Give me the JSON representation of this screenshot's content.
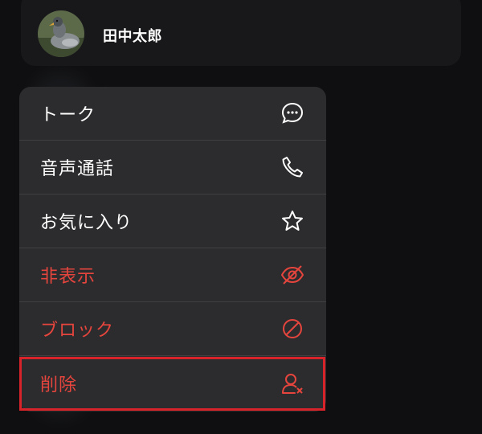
{
  "contact": {
    "name": "田中太郎",
    "avatar_icon": "duck-photo-avatar"
  },
  "menu": {
    "items": [
      {
        "label": "トーク",
        "icon": "chat-bubble-icon",
        "danger": false
      },
      {
        "label": "音声通話",
        "icon": "phone-icon",
        "danger": false
      },
      {
        "label": "お気に入り",
        "icon": "star-icon",
        "danger": false
      },
      {
        "label": "非表示",
        "icon": "eye-slash-icon",
        "danger": true
      },
      {
        "label": "ブロック",
        "icon": "block-icon",
        "danger": true
      },
      {
        "label": "削除",
        "icon": "remove-user-icon",
        "danger": true
      }
    ],
    "highlighted_item": "削除"
  },
  "colors": {
    "danger": "#e5453d",
    "highlight_border": "#d8232a",
    "menu_bg": "#2c2c2e"
  }
}
